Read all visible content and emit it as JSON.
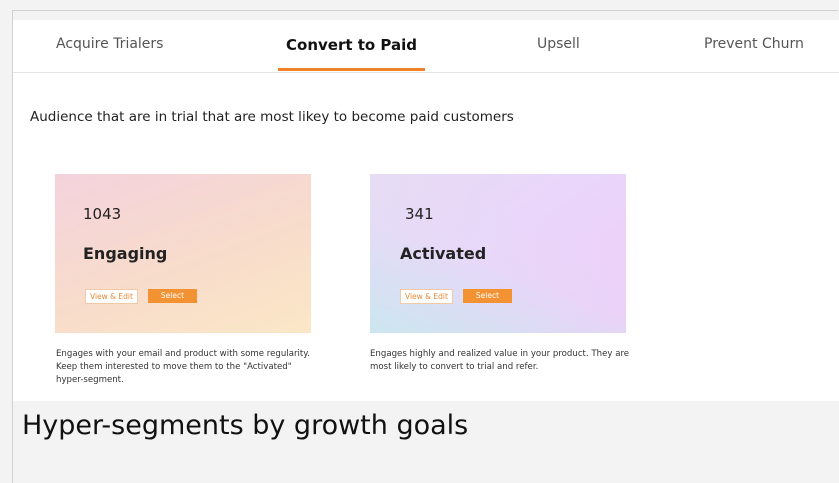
{
  "tabs": [
    {
      "label": "Acquire  Trialers",
      "active": false
    },
    {
      "label": "Convert to Paid",
      "active": true
    },
    {
      "label": "Upsell",
      "active": false
    },
    {
      "label": "Prevent Churn",
      "active": false
    }
  ],
  "accent_color": "#f0832a",
  "intro": "Audience that are in trial that are most likey to become paid customers",
  "segments": [
    {
      "count": "1043",
      "title": "Engaging",
      "view_label": "View & Edit",
      "select_label": "Select",
      "description": "Engages with your email and product with some regularity. Keep them interested to  move them to the \"Activated\" hyper-segment."
    },
    {
      "count": "341",
      "title": "Activated",
      "view_label": "View & Edit",
      "select_label": "Select",
      "description": "Engages highly and realized value in your product. They are most likely to convert to trial and refer."
    }
  ],
  "caption": "Hyper-segments by growth goals"
}
